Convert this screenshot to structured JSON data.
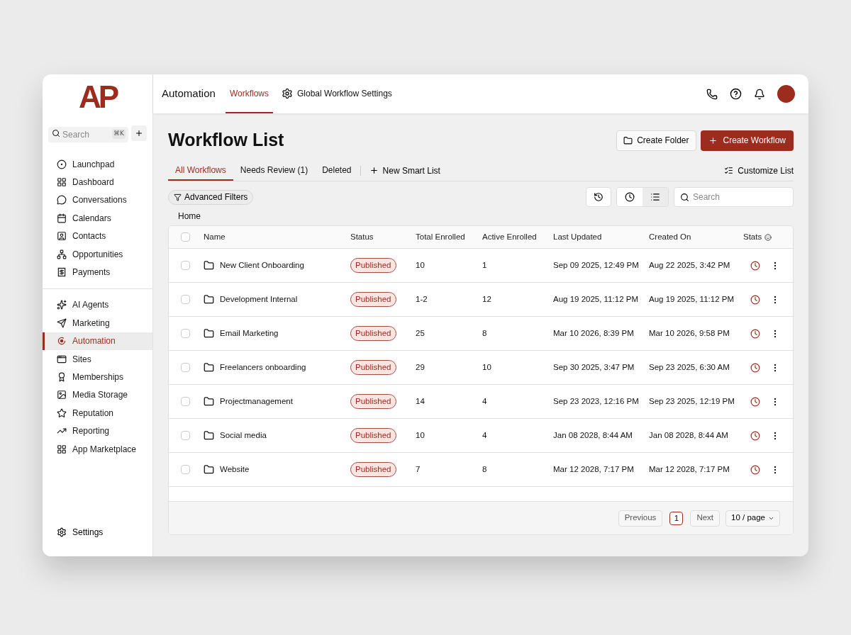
{
  "logo": "AP",
  "sidebar": {
    "search": {
      "placeholder": "Search",
      "shortcut": "⌘K"
    },
    "groups": [
      [
        {
          "label": "Launchpad",
          "selected": false
        },
        {
          "label": "Dashboard",
          "selected": false
        },
        {
          "label": "Conversations",
          "selected": false
        },
        {
          "label": "Calendars",
          "selected": false
        },
        {
          "label": "Contacts",
          "selected": false
        },
        {
          "label": "Opportunities",
          "selected": false
        },
        {
          "label": "Payments",
          "selected": false
        }
      ],
      [
        {
          "label": "AI Agents",
          "selected": false
        },
        {
          "label": "Marketing",
          "selected": false
        },
        {
          "label": "Automation",
          "selected": true
        },
        {
          "label": "Sites",
          "selected": false
        },
        {
          "label": "Memberships",
          "selected": false
        },
        {
          "label": "Media Storage",
          "selected": false
        },
        {
          "label": "Reputation",
          "selected": false
        },
        {
          "label": "Reporting",
          "selected": false
        },
        {
          "label": "App Marketplace",
          "selected": false
        }
      ]
    ],
    "footer": {
      "label": "Settings"
    }
  },
  "topbar": {
    "title": "Automation",
    "tabs": [
      {
        "label": "Workflows",
        "selected": true
      },
      {
        "label": "Global Workflow Settings",
        "selected": false
      }
    ]
  },
  "page": {
    "title": "Workflow List",
    "buttons": [
      "Create Folder",
      "Create Workflow"
    ],
    "tabs": [
      {
        "label": "All Workflows",
        "selected": true
      },
      {
        "label": "Needs Review (1)",
        "selected": false
      },
      {
        "label": "Deleted",
        "selected": false
      }
    ],
    "new_smart_list": "New Smart List",
    "customize": "Customize List",
    "filters": "Advanced Filters",
    "search": {
      "placeholder": "Search"
    },
    "breadcrumb": "Home"
  },
  "table": {
    "all_checked": false,
    "columns": [
      "Name",
      "Status",
      "Total Enrolled",
      "Active Enrolled",
      "Last Updated",
      "Created On",
      "Stats"
    ],
    "rows": [
      {
        "checked": false,
        "name": "New Client Onboarding",
        "status": "Published",
        "total": "10",
        "active": "1",
        "updated": "Sep 09 2025, 12:49 PM",
        "created": "Aug 22 2025, 3:42 PM"
      },
      {
        "checked": false,
        "name": "Development Internal",
        "status": "Published",
        "total": "1-2",
        "active": "12",
        "updated": "Aug 19 2025, 11:12 PM",
        "created": "Aug 19 2025, 11:12 PM"
      },
      {
        "checked": false,
        "name": "Email Marketing",
        "status": "Published",
        "total": "25",
        "active": "8",
        "updated": "Mar 10 2026, 8:39 PM",
        "created": "Mar 10 2026, 9:58 PM"
      },
      {
        "checked": false,
        "name": "Freelancers onboarding",
        "status": "Published",
        "total": "29",
        "active": "10",
        "updated": "Sep 30 2025, 3:47 PM",
        "created": "Sep 23 2025, 6:30 AM"
      },
      {
        "checked": false,
        "name": "Projectmanagement",
        "status": "Published",
        "total": "14",
        "active": "4",
        "updated": "Sep 23 2023, 12:16 PM",
        "created": "Sep 23 2025, 12:19 PM"
      },
      {
        "checked": false,
        "name": "Social media",
        "status": "Published",
        "total": "10",
        "active": "4",
        "updated": "Jan 08 2028, 8:44 AM",
        "created": "Jan 08 2028, 8:44 AM"
      },
      {
        "checked": false,
        "name": "Website",
        "status": "Published",
        "total": "7",
        "active": "8",
        "updated": "Mar 12 2028, 7:17 PM",
        "created": "Mar 12 2028, 7:17 PM"
      }
    ]
  },
  "pagination": {
    "previous": "Previous",
    "pages": [
      {
        "label": "1",
        "selected": true
      }
    ],
    "next": "Next",
    "page_size": "10 / page"
  }
}
